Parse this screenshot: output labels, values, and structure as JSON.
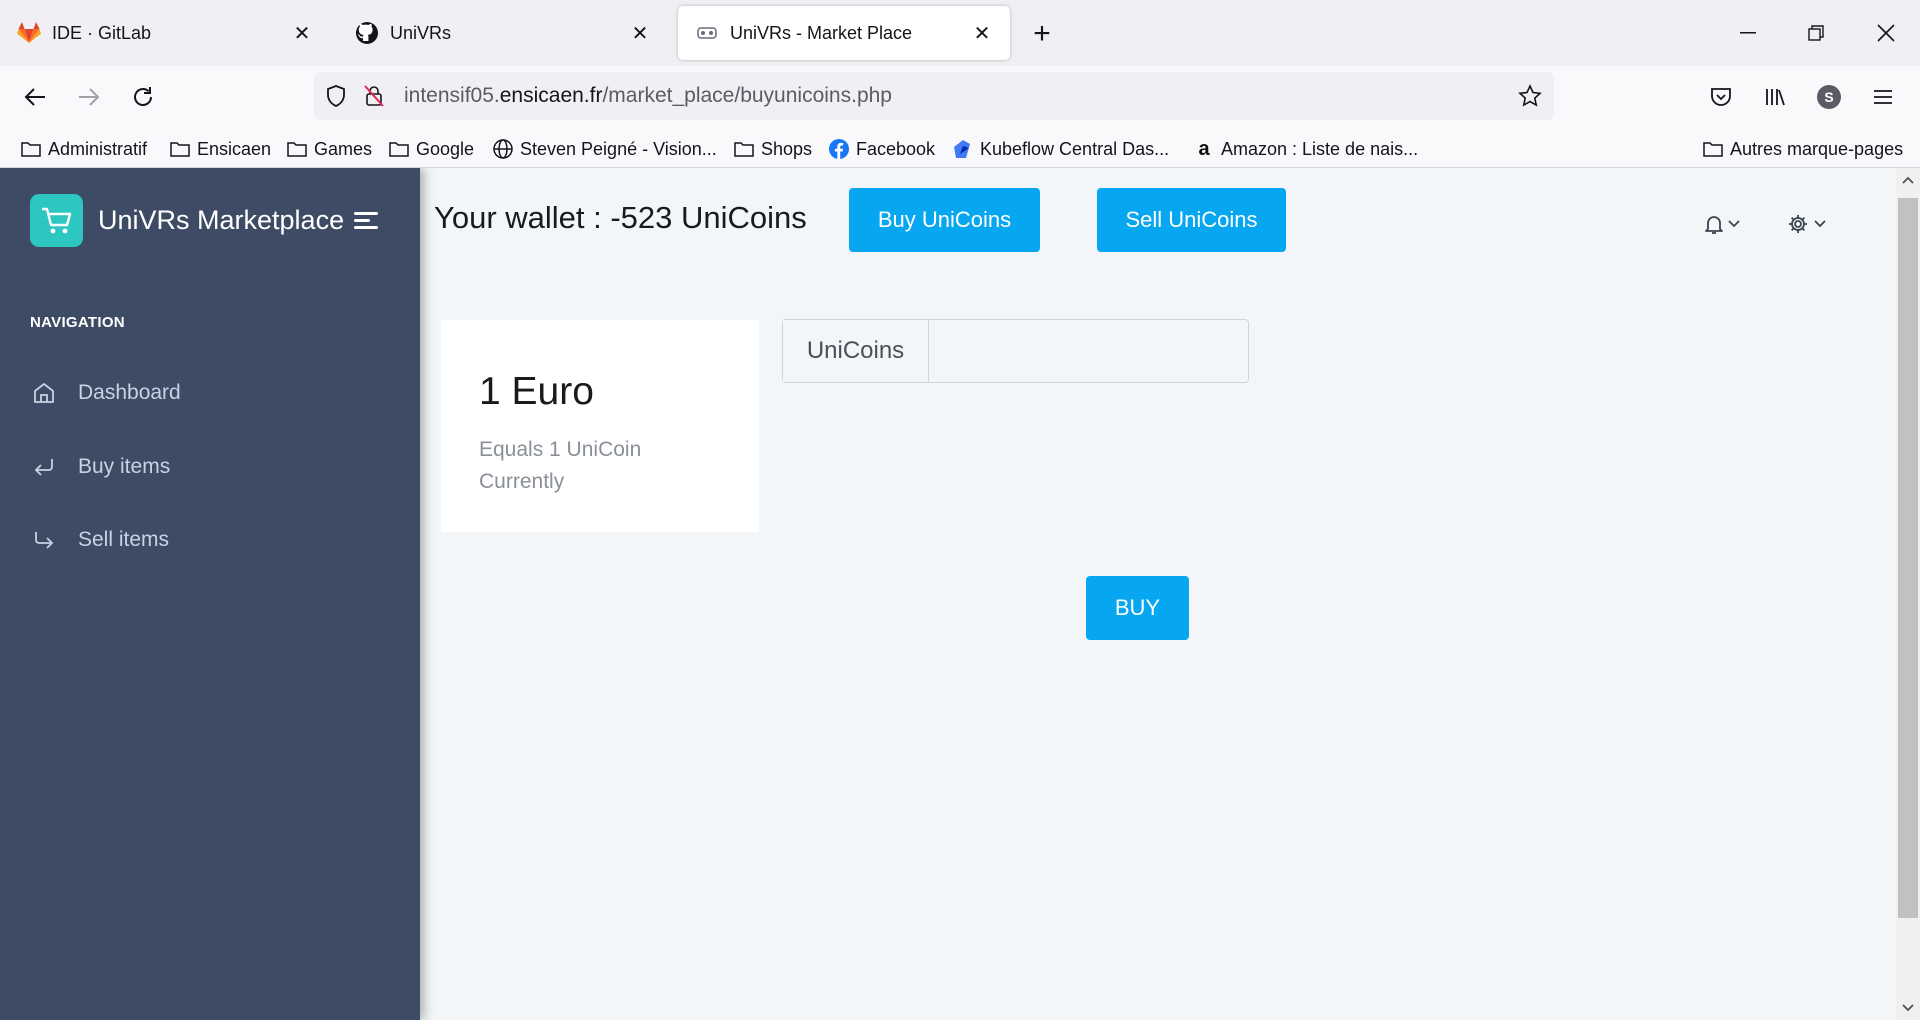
{
  "browser": {
    "tabs": [
      {
        "label": "IDE · GitLab",
        "icon": "gitlab-icon",
        "active": false
      },
      {
        "label": "UniVRs",
        "icon": "github-icon",
        "active": false
      },
      {
        "label": "UniVRs - Market Place",
        "icon": "vr-headset-icon",
        "active": true
      }
    ],
    "url": {
      "prefix": "intensif05.",
      "domain": "ensicaen.fr",
      "path": "/market_place/buyunicoins.php"
    },
    "profile_initial": "S",
    "bookmarks": [
      {
        "label": "Administratif",
        "icon": "folder-icon"
      },
      {
        "label": "Ensicaen",
        "icon": "folder-icon"
      },
      {
        "label": "Games",
        "icon": "folder-icon"
      },
      {
        "label": "Google",
        "icon": "folder-icon"
      },
      {
        "label": "Steven Peigné - Vision...",
        "icon": "globe-icon"
      },
      {
        "label": "Shops",
        "icon": "folder-icon"
      },
      {
        "label": "Facebook",
        "icon": "facebook-icon"
      },
      {
        "label": "Kubeflow Central Das...",
        "icon": "kubeflow-icon"
      },
      {
        "label": "Amazon : Liste de nais...",
        "icon": "amazon-icon"
      }
    ],
    "other_bookmarks": "Autres marque-pages"
  },
  "sidebar": {
    "brand": "UniVRs Marketplace",
    "heading": "NAVIGATION",
    "items": [
      {
        "label": "Dashboard",
        "icon": "home-icon"
      },
      {
        "label": "Buy items",
        "icon": "return-arrow-icon"
      },
      {
        "label": "Sell items",
        "icon": "down-right-arrow-icon"
      }
    ]
  },
  "header": {
    "wallet": "Your wallet : -523 UniCoins",
    "buy_label": "Buy UniCoins",
    "sell_label": "Sell UniCoins"
  },
  "rate_card": {
    "title": "1 Euro",
    "subtitle_line1": "Equals 1 UniCoin",
    "subtitle_line2": "Currently"
  },
  "form": {
    "addon_label": "UniCoins",
    "input_value": "",
    "submit_label": "BUY"
  },
  "colors": {
    "primary": "#06a6f0",
    "sidebar": "#3e4b64",
    "brand_logo": "#2cc7c0"
  }
}
